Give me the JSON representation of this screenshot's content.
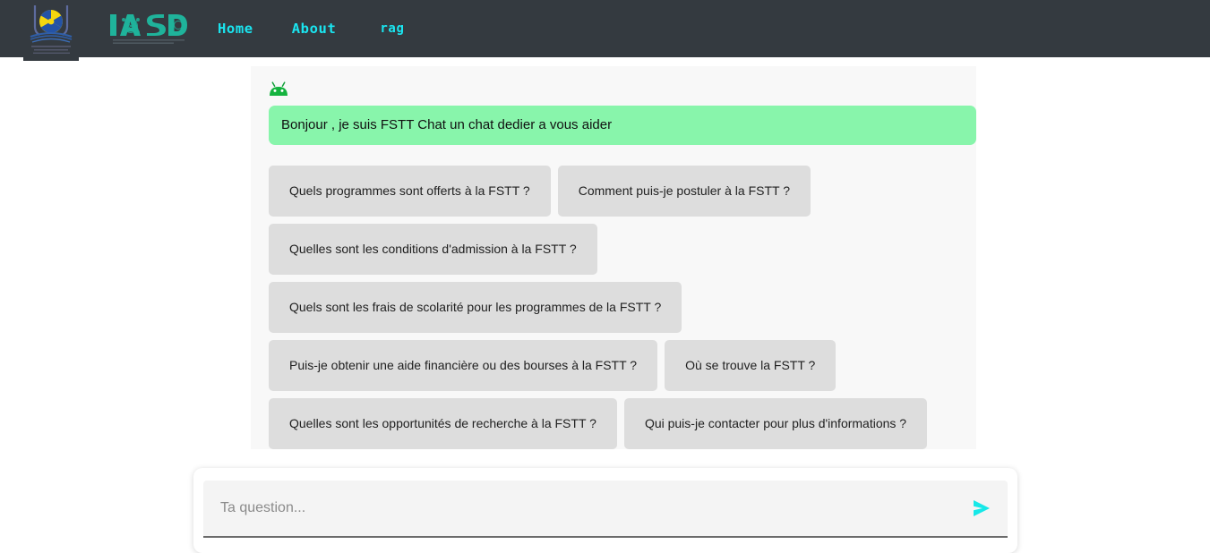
{
  "header": {
    "university_logo_alt": "university-crest-logo",
    "brand_logo_text": "IASD",
    "brand_logo_subtitle": "INTELLIGENCE ARTIFICIELLE ET SCIENCES DE DONNEES",
    "nav": [
      {
        "label": "Home",
        "name": "nav-link-home"
      },
      {
        "label": "About",
        "name": "nav-link-about"
      },
      {
        "label": "rag",
        "name": "nav-link-rag"
      }
    ],
    "colors": {
      "background": "#343a40",
      "link": "#1ae5f0",
      "brand": "#1fb8a0"
    }
  },
  "chat": {
    "bot_avatar_icon": "android-robot-icon",
    "bot_message": "Bonjour , je suis FSTT Chat un chat dedier a vous aider",
    "bubble_color": "#88f5ab",
    "suggestions": [
      "Quels programmes sont offerts à la FSTT ?",
      "Comment puis-je postuler à la FSTT ?",
      "Quelles sont les conditions d'admission à la FSTT ?",
      "Quels sont les frais de scolarité pour les programmes de la FSTT ?",
      "Puis-je obtenir une aide financière ou des bourses à la FSTT ?",
      "Où se trouve la FSTT ?",
      "Quelles sont les opportunités de recherche à la FSTT ?",
      "Qui puis-je contacter pour plus d'informations ?"
    ]
  },
  "composer": {
    "placeholder": "Ta question...",
    "value": "",
    "send_icon": "send-arrow-icon",
    "send_color": "#16e8e8"
  }
}
